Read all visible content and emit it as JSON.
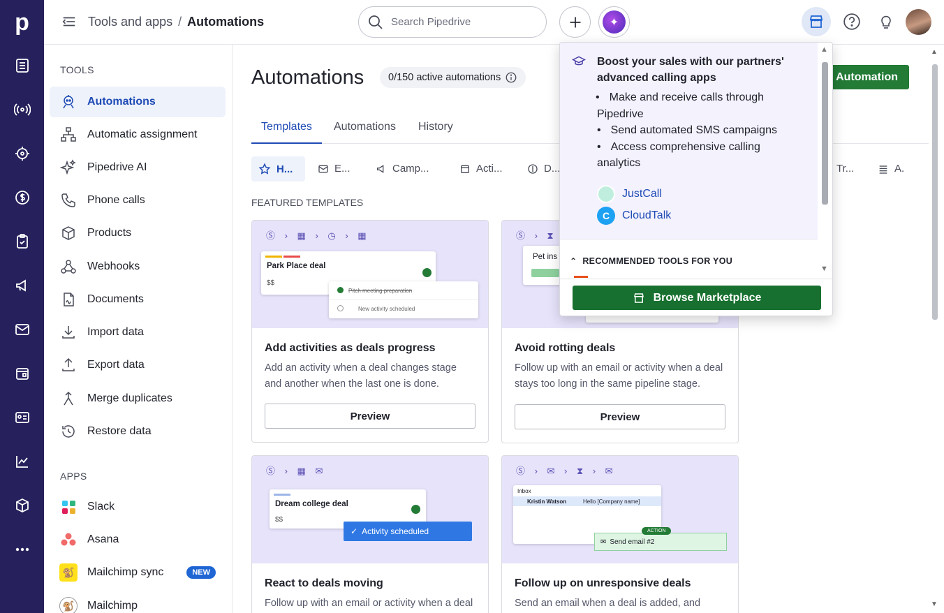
{
  "header": {
    "breadcrumb_parent": "Tools and apps",
    "breadcrumb_sep": "/",
    "breadcrumb_current": "Automations",
    "search_placeholder": "Search Pipedrive"
  },
  "sidebar": {
    "tools_heading": "TOOLS",
    "items": [
      {
        "label": "Automations"
      },
      {
        "label": "Automatic assignment"
      },
      {
        "label": "Pipedrive AI"
      },
      {
        "label": "Phone calls"
      },
      {
        "label": "Products"
      },
      {
        "label": "Webhooks"
      },
      {
        "label": "Documents"
      },
      {
        "label": "Import data"
      },
      {
        "label": "Export data"
      },
      {
        "label": "Merge duplicates"
      },
      {
        "label": "Restore data"
      }
    ],
    "apps_heading": "APPS",
    "apps": [
      {
        "label": "Slack"
      },
      {
        "label": "Asana"
      },
      {
        "label": "Mailchimp sync",
        "badge": "NEW"
      },
      {
        "label": "Mailchimp"
      }
    ]
  },
  "main": {
    "title": "Automations",
    "active_count": "0/150 active automations",
    "add_button": "Automation",
    "tabs": [
      "Templates",
      "Automations",
      "History"
    ],
    "filters": [
      "H...",
      "E...",
      "Camp...",
      "Acti...",
      "D...",
      "Tr...",
      "A."
    ],
    "featured_heading": "FEATURED TEMPLATES",
    "cards": [
      {
        "title": "Add activities as deals progress",
        "desc": "Add an activity when a deal changes stage and another when the last one is done.",
        "button": "Preview",
        "img": {
          "deal": "Park Place deal",
          "money": "$$",
          "row1": "Pitch meeting preparation",
          "row2": "New activity scheduled"
        }
      },
      {
        "title": "Avoid rotting deals",
        "desc": "Follow up with an email or activity when a deal stays too long in the same pipeline stage.",
        "button": "Preview",
        "img": {
          "deal": "Pet ins"
        }
      },
      {
        "title": "React to deals moving",
        "desc": "Follow up with an email or activity when a deal",
        "button": "Preview",
        "img": {
          "deal": "Dream college deal",
          "money": "$$",
          "toast": "Activity scheduled"
        }
      },
      {
        "title": "Follow up on unresponsive deals",
        "desc": "Send an email when a deal is added, and",
        "button": "Preview",
        "img": {
          "inbox": "Inbox",
          "person": "Kristin Watson",
          "subject": "Hello [Company name]",
          "action": "ACTION",
          "send": "Send email #2"
        }
      }
    ]
  },
  "popover": {
    "headline": "Boost your sales with our partners' advanced calling apps",
    "bullets": [
      "Make and receive calls through Pipedrive",
      "Send automated SMS campaigns",
      "Access comprehensive calling analytics"
    ],
    "partners": [
      "JustCall",
      "CloudTalk"
    ],
    "recommended": "RECOMMENDED TOOLS FOR YOU",
    "cta": "Browse Marketplace"
  },
  "colors": {
    "rail": "#26215c",
    "accent_blue": "#1f4bb5",
    "green": "#237b36",
    "card_bg": "#e6e3fb"
  }
}
